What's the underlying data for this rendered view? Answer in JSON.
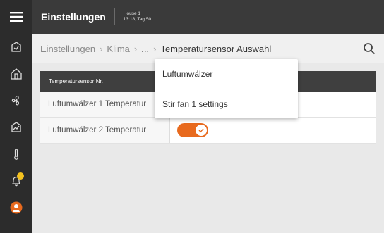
{
  "header": {
    "title": "Einstellungen",
    "house_name": "House 1",
    "house_time": "13:18, Tag 50"
  },
  "breadcrumb": {
    "items": [
      "Einstellungen",
      "Klima",
      "..."
    ],
    "separator": "›",
    "current": "Temperatursensor Auswahl"
  },
  "table": {
    "header": "Temperatursensor Nr.",
    "rows": [
      {
        "label": "Luftumwälzer 1 Temperatur",
        "toggle_on": true
      },
      {
        "label": "Luftumwälzer 2 Temperatur",
        "toggle_on": true
      }
    ]
  },
  "dropdown": {
    "items": [
      "Luftumwälzer",
      "Stir fan 1 settings"
    ]
  },
  "colors": {
    "accent": "#e86a1e",
    "sidebar": "#2c2c2c",
    "header": "#3a3a3a",
    "badge": "#f4c21f"
  },
  "icons": [
    "menu-icon",
    "dashboard-icon",
    "house-icon",
    "fan-icon",
    "chart-icon",
    "thermometer-icon",
    "bell-icon",
    "avatar-icon",
    "search-icon",
    "check-icon"
  ]
}
